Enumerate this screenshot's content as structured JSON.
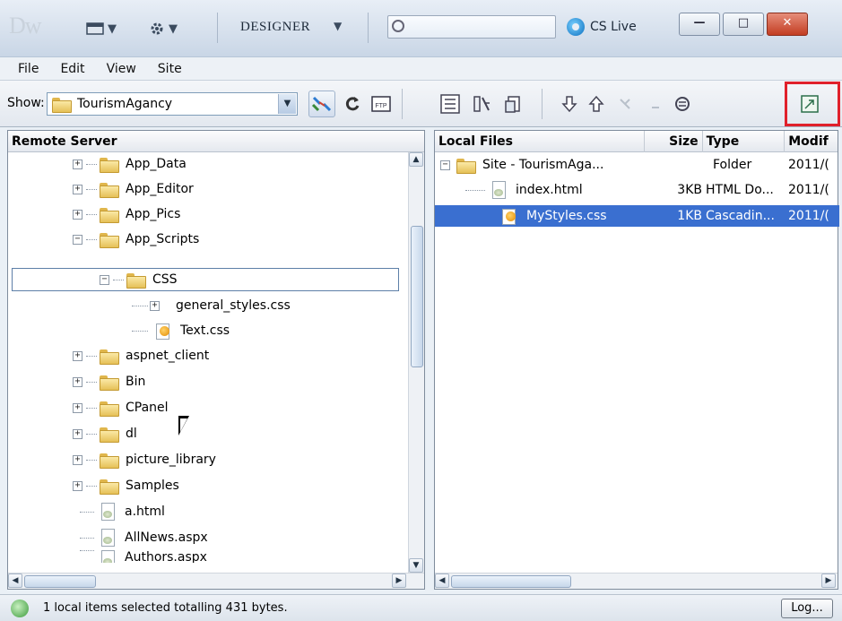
{
  "titlebar": {
    "logo": "Dw",
    "workspace": "DESIGNER",
    "cslive": "CS Live",
    "minimize": "—",
    "maximize": "□",
    "close": "✕"
  },
  "menu": [
    "File",
    "Edit",
    "View",
    "Site"
  ],
  "toolbar": {
    "show_label": "Show:",
    "site": "TourismAgancy",
    "ftp_label": "FTP"
  },
  "remote": {
    "header": "Remote Server",
    "items": [
      {
        "label": "App_Data",
        "type": "folder",
        "state": "+"
      },
      {
        "label": "App_Editor",
        "type": "folder",
        "state": "+"
      },
      {
        "label": "App_Pics",
        "type": "folder",
        "state": "+"
      },
      {
        "label": "App_Scripts",
        "type": "folder",
        "state": "−"
      },
      {
        "label": "CSS",
        "type": "folder",
        "state": "−"
      },
      {
        "label": "general_styles.css",
        "type": "css"
      },
      {
        "label": "Text.css",
        "type": "css"
      },
      {
        "label": "aspnet_client",
        "type": "folder",
        "state": "+"
      },
      {
        "label": "Bin",
        "type": "folder",
        "state": "+"
      },
      {
        "label": "CPanel",
        "type": "folder",
        "state": "+"
      },
      {
        "label": "dl",
        "type": "folder",
        "state": "+"
      },
      {
        "label": "picture_library",
        "type": "folder",
        "state": "+"
      },
      {
        "label": "Samples",
        "type": "folder",
        "state": "+"
      },
      {
        "label": "a.html",
        "type": "file"
      },
      {
        "label": "AllNews.aspx",
        "type": "file"
      },
      {
        "label": "Authors.aspx",
        "type": "file"
      }
    ]
  },
  "local": {
    "columns": [
      "Local Files",
      "Size",
      "Type",
      "Modif"
    ],
    "rows": [
      {
        "name": "Site - TourismAga...",
        "size": "",
        "type": "Folder",
        "modified": "2011/(",
        "kind": "folder"
      },
      {
        "name": "index.html",
        "size": "3KB",
        "type": "HTML Do...",
        "modified": "2011/(",
        "kind": "file"
      },
      {
        "name": "MyStyles.css",
        "size": "1KB",
        "type": "Cascadin...",
        "modified": "2011/(",
        "kind": "css",
        "selected": true
      }
    ]
  },
  "status": {
    "text": "1 local items selected totalling 431 bytes.",
    "log_button": "Log..."
  }
}
